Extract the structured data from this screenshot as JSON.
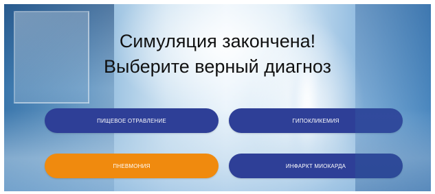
{
  "screen": {
    "title_line1": "Симуляция закончена!",
    "title_line2": "Выберите верный диагноз"
  },
  "options": [
    {
      "label": "ПИЩЕВОЕ ОТРАВЛЕНИЕ",
      "color": "#2e3f97"
    },
    {
      "label": "ГИПОКЛИКЕМИЯ",
      "color": "#2e3f97"
    },
    {
      "label": "ПНЕВМОНИЯ",
      "color": "#f08a0e"
    },
    {
      "label": "ИНФАРКТ МИОКАРДА",
      "color": "#2e3f97"
    }
  ]
}
